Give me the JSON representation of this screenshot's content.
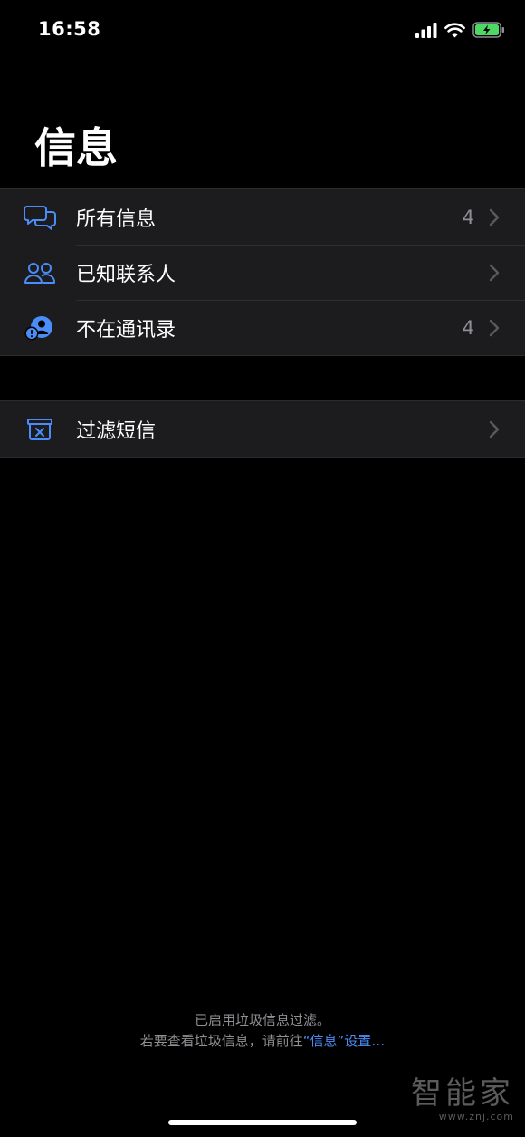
{
  "status_bar": {
    "time": "16:58",
    "icons": [
      "cellular-signal-icon",
      "wifi-icon",
      "battery-charging-icon"
    ],
    "battery_color": "#4cd964"
  },
  "page": {
    "title": "信息"
  },
  "list_groups": [
    {
      "items": [
        {
          "label": "所有信息",
          "count": "4",
          "icon": "chat-bubbles-icon"
        },
        {
          "label": "已知联系人",
          "count": "",
          "icon": "contacts-icon"
        },
        {
          "label": "不在通讯录",
          "count": "4",
          "icon": "unknown-sender-icon"
        }
      ]
    },
    {
      "items": [
        {
          "label": "过滤短信",
          "count": "",
          "icon": "junk-filter-icon"
        }
      ]
    }
  ],
  "footer": {
    "line1": "已启用垃圾信息过滤。",
    "line2_prefix": "若要查看垃圾信息，请前往",
    "line2_link": "“信息”设置…"
  },
  "watermark": {
    "main": "智能家",
    "url": "www.znj.com"
  },
  "colors": {
    "background": "#000000",
    "row_background": "#1c1c1e",
    "accent": "#4a8df8",
    "secondary_text": "#8e8e93"
  }
}
